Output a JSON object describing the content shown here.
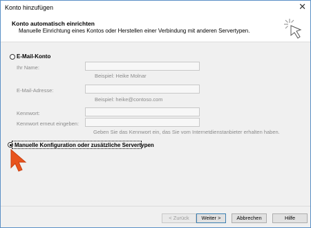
{
  "window": {
    "title": "Konto hinzufügen",
    "close_glyph": "✕"
  },
  "header": {
    "title": "Konto automatisch einrichten",
    "subtitle": "Manuelle Einrichtung eines Kontos oder Herstellen einer Verbindung mit anderen Servertypen.",
    "icon": "wizard-sparkle-icon"
  },
  "email_option": {
    "label": "E-Mail-Konto",
    "selected": false,
    "fields": [
      {
        "label": "Ihr Name:",
        "value": "",
        "hint": "Beispiel: Heike Molnar"
      },
      {
        "label": "E-Mail-Adresse:",
        "value": "",
        "hint": "Beispiel: heike@contoso.com"
      },
      {
        "label": "Kennwort:",
        "value": "",
        "hint": ""
      },
      {
        "label": "Kennwort erneut eingeben:",
        "value": "",
        "hint": "Geben Sie das Kennwort ein, das Sie vom Internetdienstanbieter erhalten haben."
      }
    ]
  },
  "manual_option": {
    "label": "Manuelle Konfiguration oder zusätzliche Servertypen",
    "selected": true
  },
  "buttons": {
    "back": "< Zurück",
    "next": "Weiter >",
    "cancel": "Abbrechen",
    "help": "Hilfe"
  },
  "colors": {
    "cursor": "#e8541e",
    "accent": "#3c7fb1"
  }
}
